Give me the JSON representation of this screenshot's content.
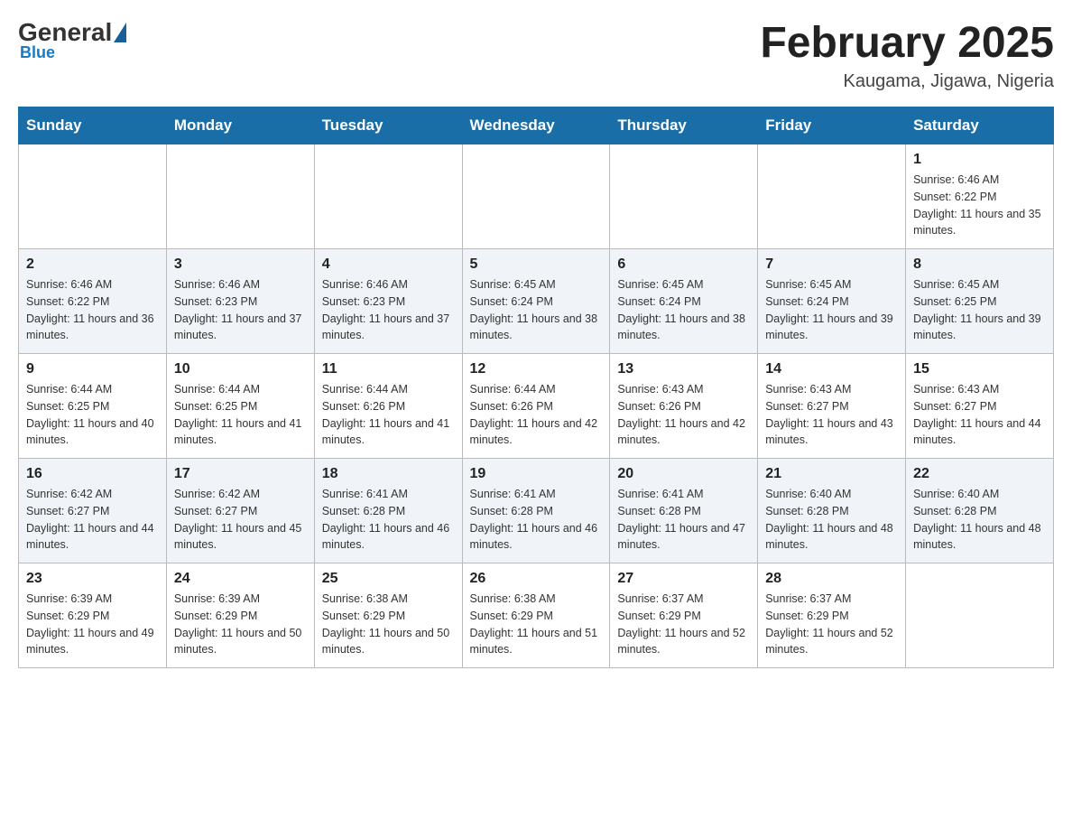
{
  "header": {
    "logo": {
      "general": "General",
      "blue": "Blue"
    },
    "title": "February 2025",
    "location": "Kaugama, Jigawa, Nigeria"
  },
  "days_of_week": [
    "Sunday",
    "Monday",
    "Tuesday",
    "Wednesday",
    "Thursday",
    "Friday",
    "Saturday"
  ],
  "weeks": [
    [
      {
        "day": "",
        "info": ""
      },
      {
        "day": "",
        "info": ""
      },
      {
        "day": "",
        "info": ""
      },
      {
        "day": "",
        "info": ""
      },
      {
        "day": "",
        "info": ""
      },
      {
        "day": "",
        "info": ""
      },
      {
        "day": "1",
        "info": "Sunrise: 6:46 AM\nSunset: 6:22 PM\nDaylight: 11 hours and 35 minutes."
      }
    ],
    [
      {
        "day": "2",
        "info": "Sunrise: 6:46 AM\nSunset: 6:22 PM\nDaylight: 11 hours and 36 minutes."
      },
      {
        "day": "3",
        "info": "Sunrise: 6:46 AM\nSunset: 6:23 PM\nDaylight: 11 hours and 37 minutes."
      },
      {
        "day": "4",
        "info": "Sunrise: 6:46 AM\nSunset: 6:23 PM\nDaylight: 11 hours and 37 minutes."
      },
      {
        "day": "5",
        "info": "Sunrise: 6:45 AM\nSunset: 6:24 PM\nDaylight: 11 hours and 38 minutes."
      },
      {
        "day": "6",
        "info": "Sunrise: 6:45 AM\nSunset: 6:24 PM\nDaylight: 11 hours and 38 minutes."
      },
      {
        "day": "7",
        "info": "Sunrise: 6:45 AM\nSunset: 6:24 PM\nDaylight: 11 hours and 39 minutes."
      },
      {
        "day": "8",
        "info": "Sunrise: 6:45 AM\nSunset: 6:25 PM\nDaylight: 11 hours and 39 minutes."
      }
    ],
    [
      {
        "day": "9",
        "info": "Sunrise: 6:44 AM\nSunset: 6:25 PM\nDaylight: 11 hours and 40 minutes."
      },
      {
        "day": "10",
        "info": "Sunrise: 6:44 AM\nSunset: 6:25 PM\nDaylight: 11 hours and 41 minutes."
      },
      {
        "day": "11",
        "info": "Sunrise: 6:44 AM\nSunset: 6:26 PM\nDaylight: 11 hours and 41 minutes."
      },
      {
        "day": "12",
        "info": "Sunrise: 6:44 AM\nSunset: 6:26 PM\nDaylight: 11 hours and 42 minutes."
      },
      {
        "day": "13",
        "info": "Sunrise: 6:43 AM\nSunset: 6:26 PM\nDaylight: 11 hours and 42 minutes."
      },
      {
        "day": "14",
        "info": "Sunrise: 6:43 AM\nSunset: 6:27 PM\nDaylight: 11 hours and 43 minutes."
      },
      {
        "day": "15",
        "info": "Sunrise: 6:43 AM\nSunset: 6:27 PM\nDaylight: 11 hours and 44 minutes."
      }
    ],
    [
      {
        "day": "16",
        "info": "Sunrise: 6:42 AM\nSunset: 6:27 PM\nDaylight: 11 hours and 44 minutes."
      },
      {
        "day": "17",
        "info": "Sunrise: 6:42 AM\nSunset: 6:27 PM\nDaylight: 11 hours and 45 minutes."
      },
      {
        "day": "18",
        "info": "Sunrise: 6:41 AM\nSunset: 6:28 PM\nDaylight: 11 hours and 46 minutes."
      },
      {
        "day": "19",
        "info": "Sunrise: 6:41 AM\nSunset: 6:28 PM\nDaylight: 11 hours and 46 minutes."
      },
      {
        "day": "20",
        "info": "Sunrise: 6:41 AM\nSunset: 6:28 PM\nDaylight: 11 hours and 47 minutes."
      },
      {
        "day": "21",
        "info": "Sunrise: 6:40 AM\nSunset: 6:28 PM\nDaylight: 11 hours and 48 minutes."
      },
      {
        "day": "22",
        "info": "Sunrise: 6:40 AM\nSunset: 6:28 PM\nDaylight: 11 hours and 48 minutes."
      }
    ],
    [
      {
        "day": "23",
        "info": "Sunrise: 6:39 AM\nSunset: 6:29 PM\nDaylight: 11 hours and 49 minutes."
      },
      {
        "day": "24",
        "info": "Sunrise: 6:39 AM\nSunset: 6:29 PM\nDaylight: 11 hours and 50 minutes."
      },
      {
        "day": "25",
        "info": "Sunrise: 6:38 AM\nSunset: 6:29 PM\nDaylight: 11 hours and 50 minutes."
      },
      {
        "day": "26",
        "info": "Sunrise: 6:38 AM\nSunset: 6:29 PM\nDaylight: 11 hours and 51 minutes."
      },
      {
        "day": "27",
        "info": "Sunrise: 6:37 AM\nSunset: 6:29 PM\nDaylight: 11 hours and 52 minutes."
      },
      {
        "day": "28",
        "info": "Sunrise: 6:37 AM\nSunset: 6:29 PM\nDaylight: 11 hours and 52 minutes."
      },
      {
        "day": "",
        "info": ""
      }
    ]
  ]
}
